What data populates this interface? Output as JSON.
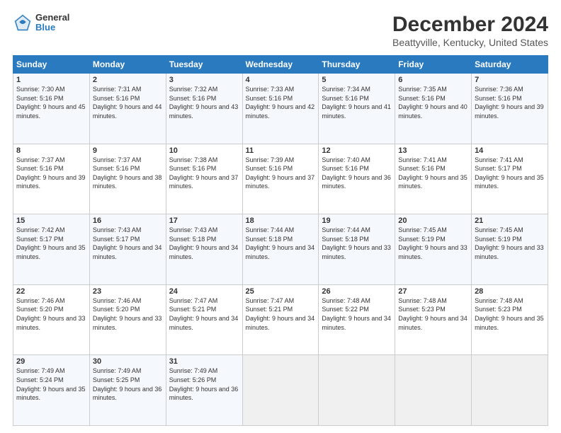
{
  "logo": {
    "general": "General",
    "blue": "Blue"
  },
  "title": "December 2024",
  "subtitle": "Beattyville, Kentucky, United States",
  "headers": [
    "Sunday",
    "Monday",
    "Tuesday",
    "Wednesday",
    "Thursday",
    "Friday",
    "Saturday"
  ],
  "weeks": [
    [
      {
        "day": "1",
        "sunrise": "Sunrise: 7:30 AM",
        "sunset": "Sunset: 5:16 PM",
        "daylight": "Daylight: 9 hours and 45 minutes."
      },
      {
        "day": "2",
        "sunrise": "Sunrise: 7:31 AM",
        "sunset": "Sunset: 5:16 PM",
        "daylight": "Daylight: 9 hours and 44 minutes."
      },
      {
        "day": "3",
        "sunrise": "Sunrise: 7:32 AM",
        "sunset": "Sunset: 5:16 PM",
        "daylight": "Daylight: 9 hours and 43 minutes."
      },
      {
        "day": "4",
        "sunrise": "Sunrise: 7:33 AM",
        "sunset": "Sunset: 5:16 PM",
        "daylight": "Daylight: 9 hours and 42 minutes."
      },
      {
        "day": "5",
        "sunrise": "Sunrise: 7:34 AM",
        "sunset": "Sunset: 5:16 PM",
        "daylight": "Daylight: 9 hours and 41 minutes."
      },
      {
        "day": "6",
        "sunrise": "Sunrise: 7:35 AM",
        "sunset": "Sunset: 5:16 PM",
        "daylight": "Daylight: 9 hours and 40 minutes."
      },
      {
        "day": "7",
        "sunrise": "Sunrise: 7:36 AM",
        "sunset": "Sunset: 5:16 PM",
        "daylight": "Daylight: 9 hours and 39 minutes."
      }
    ],
    [
      {
        "day": "8",
        "sunrise": "Sunrise: 7:37 AM",
        "sunset": "Sunset: 5:16 PM",
        "daylight": "Daylight: 9 hours and 39 minutes."
      },
      {
        "day": "9",
        "sunrise": "Sunrise: 7:37 AM",
        "sunset": "Sunset: 5:16 PM",
        "daylight": "Daylight: 9 hours and 38 minutes."
      },
      {
        "day": "10",
        "sunrise": "Sunrise: 7:38 AM",
        "sunset": "Sunset: 5:16 PM",
        "daylight": "Daylight: 9 hours and 37 minutes."
      },
      {
        "day": "11",
        "sunrise": "Sunrise: 7:39 AM",
        "sunset": "Sunset: 5:16 PM",
        "daylight": "Daylight: 9 hours and 37 minutes."
      },
      {
        "day": "12",
        "sunrise": "Sunrise: 7:40 AM",
        "sunset": "Sunset: 5:16 PM",
        "daylight": "Daylight: 9 hours and 36 minutes."
      },
      {
        "day": "13",
        "sunrise": "Sunrise: 7:41 AM",
        "sunset": "Sunset: 5:16 PM",
        "daylight": "Daylight: 9 hours and 35 minutes."
      },
      {
        "day": "14",
        "sunrise": "Sunrise: 7:41 AM",
        "sunset": "Sunset: 5:17 PM",
        "daylight": "Daylight: 9 hours and 35 minutes."
      }
    ],
    [
      {
        "day": "15",
        "sunrise": "Sunrise: 7:42 AM",
        "sunset": "Sunset: 5:17 PM",
        "daylight": "Daylight: 9 hours and 35 minutes."
      },
      {
        "day": "16",
        "sunrise": "Sunrise: 7:43 AM",
        "sunset": "Sunset: 5:17 PM",
        "daylight": "Daylight: 9 hours and 34 minutes."
      },
      {
        "day": "17",
        "sunrise": "Sunrise: 7:43 AM",
        "sunset": "Sunset: 5:18 PM",
        "daylight": "Daylight: 9 hours and 34 minutes."
      },
      {
        "day": "18",
        "sunrise": "Sunrise: 7:44 AM",
        "sunset": "Sunset: 5:18 PM",
        "daylight": "Daylight: 9 hours and 34 minutes."
      },
      {
        "day": "19",
        "sunrise": "Sunrise: 7:44 AM",
        "sunset": "Sunset: 5:18 PM",
        "daylight": "Daylight: 9 hours and 33 minutes."
      },
      {
        "day": "20",
        "sunrise": "Sunrise: 7:45 AM",
        "sunset": "Sunset: 5:19 PM",
        "daylight": "Daylight: 9 hours and 33 minutes."
      },
      {
        "day": "21",
        "sunrise": "Sunrise: 7:45 AM",
        "sunset": "Sunset: 5:19 PM",
        "daylight": "Daylight: 9 hours and 33 minutes."
      }
    ],
    [
      {
        "day": "22",
        "sunrise": "Sunrise: 7:46 AM",
        "sunset": "Sunset: 5:20 PM",
        "daylight": "Daylight: 9 hours and 33 minutes."
      },
      {
        "day": "23",
        "sunrise": "Sunrise: 7:46 AM",
        "sunset": "Sunset: 5:20 PM",
        "daylight": "Daylight: 9 hours and 33 minutes."
      },
      {
        "day": "24",
        "sunrise": "Sunrise: 7:47 AM",
        "sunset": "Sunset: 5:21 PM",
        "daylight": "Daylight: 9 hours and 34 minutes."
      },
      {
        "day": "25",
        "sunrise": "Sunrise: 7:47 AM",
        "sunset": "Sunset: 5:21 PM",
        "daylight": "Daylight: 9 hours and 34 minutes."
      },
      {
        "day": "26",
        "sunrise": "Sunrise: 7:48 AM",
        "sunset": "Sunset: 5:22 PM",
        "daylight": "Daylight: 9 hours and 34 minutes."
      },
      {
        "day": "27",
        "sunrise": "Sunrise: 7:48 AM",
        "sunset": "Sunset: 5:23 PM",
        "daylight": "Daylight: 9 hours and 34 minutes."
      },
      {
        "day": "28",
        "sunrise": "Sunrise: 7:48 AM",
        "sunset": "Sunset: 5:23 PM",
        "daylight": "Daylight: 9 hours and 35 minutes."
      }
    ],
    [
      {
        "day": "29",
        "sunrise": "Sunrise: 7:49 AM",
        "sunset": "Sunset: 5:24 PM",
        "daylight": "Daylight: 9 hours and 35 minutes."
      },
      {
        "day": "30",
        "sunrise": "Sunrise: 7:49 AM",
        "sunset": "Sunset: 5:25 PM",
        "daylight": "Daylight: 9 hours and 36 minutes."
      },
      {
        "day": "31",
        "sunrise": "Sunrise: 7:49 AM",
        "sunset": "Sunset: 5:26 PM",
        "daylight": "Daylight: 9 hours and 36 minutes."
      },
      null,
      null,
      null,
      null
    ]
  ]
}
